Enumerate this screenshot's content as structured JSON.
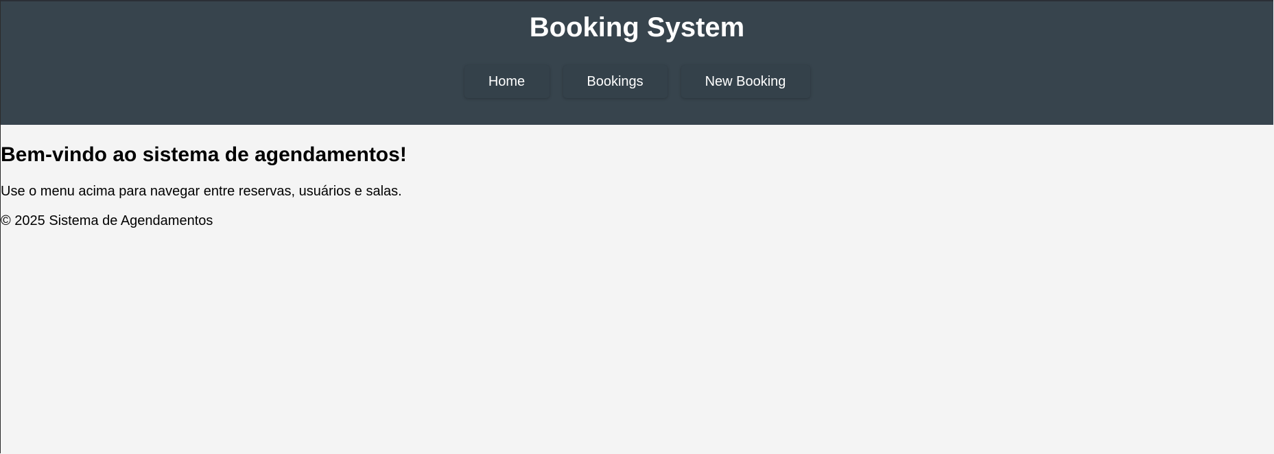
{
  "header": {
    "title": "Booking System",
    "background_color": "#37444d"
  },
  "nav": {
    "items": [
      {
        "label": "Home"
      },
      {
        "label": "Bookings"
      },
      {
        "label": "New Booking"
      }
    ]
  },
  "main": {
    "heading": "Bem-vindo ao sistema de agendamentos!",
    "text": "Use o menu acima para navegar entre reservas, usuários e salas."
  },
  "footer": {
    "text": "© 2025 Sistema de Agendamentos"
  },
  "page": {
    "background_color": "#f4f4f4"
  }
}
